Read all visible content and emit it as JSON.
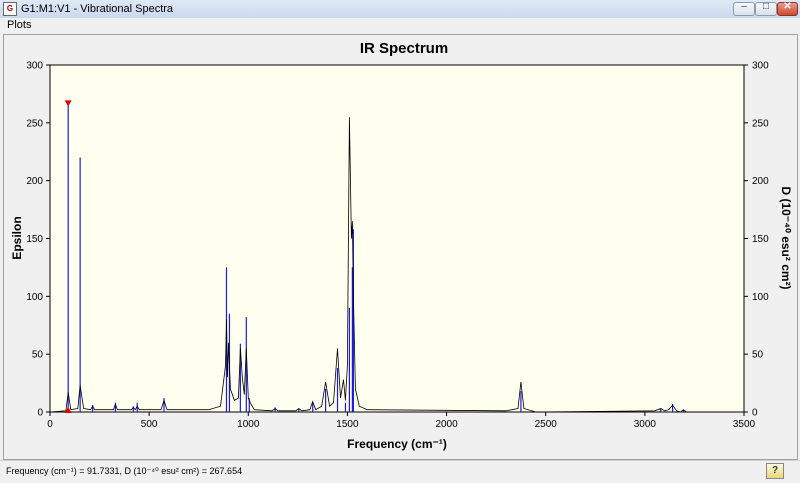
{
  "window": {
    "title": "G1:M1:V1 - Vibrational Spectra",
    "icon": "app-document-icon"
  },
  "menu": {
    "plots_label": "Plots"
  },
  "status": {
    "text": "Frequency (cm⁻¹) = 91.7331, D (10⁻⁴⁰ esu² cm²) = 267.654",
    "help_icon": "?"
  },
  "colors": {
    "plot_bg": "#fffff0",
    "stick": "#1a1ae0",
    "curve": "#000000",
    "marker": "#e00000"
  },
  "chart_data": {
    "type": "line",
    "title": "IR Spectrum",
    "xlabel": "Frequency (cm⁻¹)",
    "ylabel_left": "Epsilon",
    "ylabel_right": "D (10⁻⁴⁰ esu² cm²)",
    "xlim": [
      0,
      3500
    ],
    "ylim": [
      0,
      300
    ],
    "xticks": [
      "0",
      "500",
      "1000",
      "1500",
      "2000",
      "2500",
      "3000",
      "3500"
    ],
    "yticks": [
      "0",
      "50",
      "100",
      "150",
      "200",
      "250",
      "300"
    ],
    "series": [
      {
        "kind": "sticks",
        "x": [
          91.7,
          152,
          215,
          330,
          420,
          440,
          575,
          890,
          905,
          960,
          990,
          1005,
          1135,
          1255,
          1325,
          1390,
          1450,
          1490,
          1510,
          1525,
          1530,
          2375,
          3080,
          3140,
          3195
        ],
        "y": [
          267.7,
          220,
          6,
          8,
          5,
          8,
          12,
          125,
          85,
          59,
          82,
          12,
          4,
          3,
          8,
          20,
          38,
          8,
          90,
          125,
          158,
          18,
          3,
          7,
          2
        ]
      },
      {
        "kind": "curve",
        "x": [
          0,
          80,
          91.7,
          105,
          140,
          152,
          170,
          205,
          215,
          225,
          320,
          330,
          340,
          410,
          420,
          430,
          440,
          450,
          560,
          575,
          590,
          800,
          860,
          885,
          890,
          895,
          900,
          905,
          910,
          930,
          950,
          960,
          970,
          980,
          990,
          1000,
          1010,
          1030,
          1120,
          1135,
          1150,
          1240,
          1255,
          1270,
          1310,
          1325,
          1340,
          1370,
          1390,
          1410,
          1430,
          1450,
          1465,
          1480,
          1490,
          1500,
          1510,
          1520,
          1525,
          1530,
          1540,
          1560,
          1600,
          2300,
          2360,
          2375,
          2390,
          2450,
          3050,
          3080,
          3100,
          3120,
          3140,
          3160,
          3180,
          3195,
          3210,
          3220
        ],
        "y": [
          0,
          1,
          17,
          2,
          3,
          23,
          3,
          2,
          5,
          2,
          2,
          7,
          2,
          2,
          4,
          2,
          5,
          2,
          2,
          10,
          2,
          2,
          5,
          40,
          80,
          30,
          60,
          42,
          20,
          10,
          12,
          55,
          30,
          15,
          55,
          12,
          8,
          2,
          1,
          3,
          1,
          1,
          3,
          1,
          2,
          9,
          2,
          5,
          26,
          5,
          8,
          55,
          12,
          28,
          10,
          40,
          255,
          150,
          165,
          100,
          20,
          5,
          2,
          1,
          3,
          26,
          3,
          0,
          1,
          3,
          1,
          2,
          6,
          1,
          0,
          2,
          0,
          0
        ]
      }
    ],
    "markers": [
      {
        "x": 91.7,
        "y": 267.7,
        "shape": "triangle-down"
      },
      {
        "x": 91.7,
        "y": 0,
        "shape": "triangle-up"
      }
    ]
  }
}
